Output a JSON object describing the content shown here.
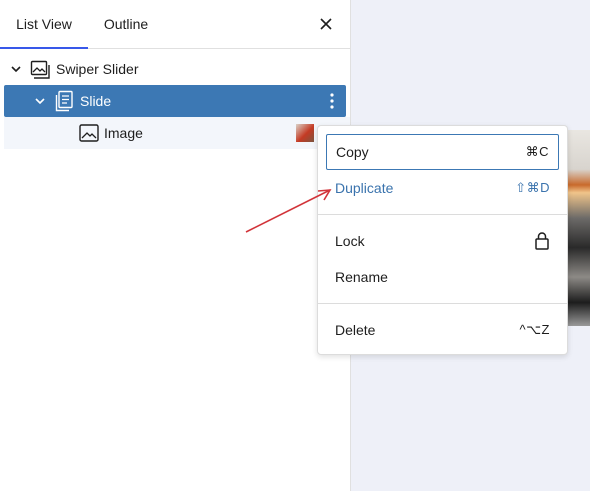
{
  "tabs": {
    "list_view": "List View",
    "outline": "Outline"
  },
  "tree": {
    "items": [
      {
        "label": "Swiper Slider",
        "level": 1,
        "expanded": true
      },
      {
        "label": "Slide",
        "level": 2,
        "expanded": true,
        "selected": true
      },
      {
        "label": "Image",
        "level": 3
      }
    ]
  },
  "menu": {
    "copy": {
      "label": "Copy",
      "shortcut": "⌘C"
    },
    "duplicate": {
      "label": "Duplicate",
      "shortcut": "⇧⌘D"
    },
    "lock": {
      "label": "Lock"
    },
    "rename": {
      "label": "Rename"
    },
    "delete": {
      "label": "Delete",
      "shortcut": "^⌥Z"
    }
  },
  "icons": {
    "close": "close-icon",
    "slider": "gallery-icon",
    "slide": "document-stack-icon",
    "image": "image-icon",
    "lock": "lock-icon",
    "options": "more-vertical-icon"
  },
  "colors": {
    "selected_row": "#3c78b4",
    "accent_blue": "#3a73ad",
    "tab_indicator": "#3858e9",
    "annotation_arrow": "#d2343a"
  }
}
